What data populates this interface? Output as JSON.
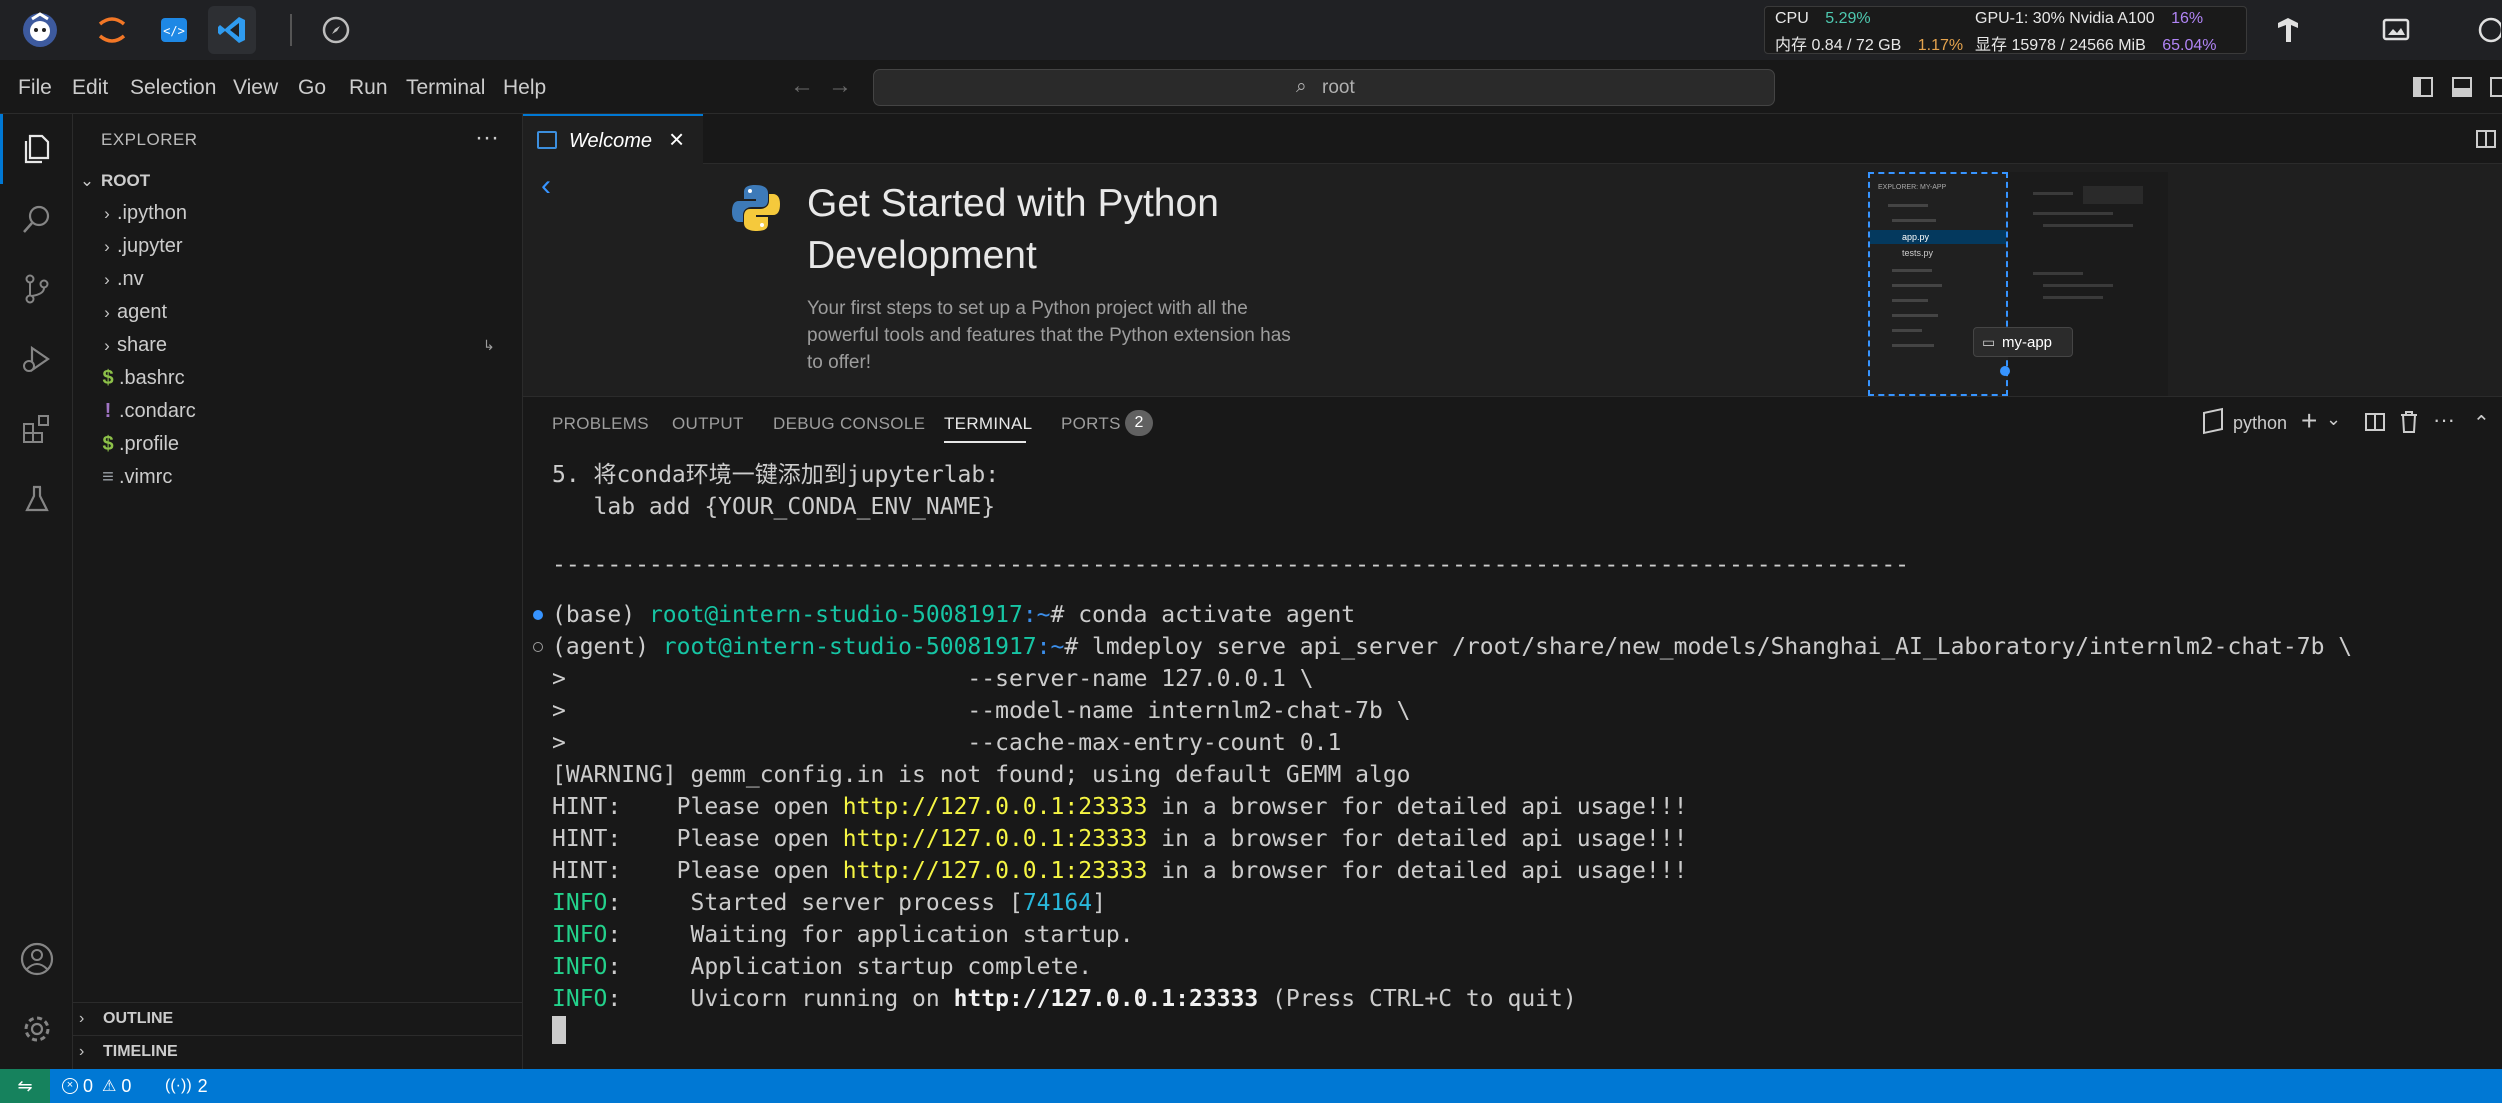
{
  "system_bar": {
    "cpu_label": "CPU",
    "cpu_value": "5.29%",
    "gpu_label": "GPU-1: 30% Nvidia A100",
    "gpu_value": "16%",
    "mem_label": "内存 0.84 / 72 GB",
    "mem_value": "1.17%",
    "vram_label": "显存 15978 / 24566 MiB",
    "vram_value": "65.04%",
    "colors": {
      "green": "#4ec9b0",
      "orange": "#e5a34d",
      "purple": "#b084f5"
    }
  },
  "menu": {
    "items": [
      "File",
      "Edit",
      "Selection",
      "View",
      "Go",
      "Run",
      "Terminal",
      "Help"
    ],
    "command_center": "root"
  },
  "sidebar": {
    "title": "EXPLORER",
    "root_label": "ROOT",
    "items": [
      {
        "label": ".ipython",
        "kind": "folder"
      },
      {
        "label": ".jupyter",
        "kind": "folder"
      },
      {
        "label": ".nv",
        "kind": "folder"
      },
      {
        "label": "agent",
        "kind": "folder"
      },
      {
        "label": "share",
        "kind": "folder"
      },
      {
        "label": ".bashrc",
        "kind": "file",
        "glyph": "$",
        "color": "#8dc149"
      },
      {
        "label": ".condarc",
        "kind": "file",
        "glyph": "!",
        "color": "#a074c4"
      },
      {
        "label": ".profile",
        "kind": "file",
        "glyph": "$",
        "color": "#8dc149"
      },
      {
        "label": ".vimrc",
        "kind": "file",
        "glyph": "≡",
        "color": "#9aa0a6"
      }
    ],
    "outline_label": "OUTLINE",
    "timeline_label": "TIMELINE"
  },
  "editor": {
    "tab_label": "Welcome",
    "welcome": {
      "title_line1": "Get Started with Python",
      "title_line2": "Development",
      "desc_line1": "Your first steps to set up a Python project with all the",
      "desc_line2": "powerful tools and features that the Python extension has",
      "desc_line3": "to offer!",
      "preview_header": "EXPLORER: MY-APP",
      "preview_file1": "app.py",
      "preview_file2": "tests.py",
      "preview_tooltip": "my-app"
    }
  },
  "panel": {
    "tabs": [
      "PROBLEMS",
      "OUTPUT",
      "DEBUG CONSOLE",
      "TERMINAL",
      "PORTS"
    ],
    "ports_badge": "2",
    "terminal_profile": "python"
  },
  "terminal": {
    "l1": "5. 将conda环境一键添加到jupyterlab:",
    "l2": "   lab add {YOUR_CONDA_ENV_NAME}",
    "separator": "--------------------------------------------------------------------------------------------------",
    "p1_env": "(base) ",
    "p1_host": "root@intern-studio-50081917",
    "p1_path": ":~",
    "p1_cmd": "# conda activate agent",
    "p2_env": "(agent) ",
    "p2_host": "root@intern-studio-50081917",
    "p2_path": ":~",
    "p2_cmd": "# lmdeploy serve api_server /root/share/new_models/Shanghai_AI_Laboratory/internlm2-chat-7b \\",
    "c1": ">                             --server-name 127.0.0.1 \\",
    "c2": ">                             --model-name internlm2-chat-7b \\",
    "c3": ">                             --cache-max-entry-count 0.1",
    "warn": "[WARNING] gemm_config.in is not found; using default GEMM algo",
    "hint_label": "HINT:    Please open ",
    "hint_url": "http://127.0.0.1:23333",
    "hint_tail": " in a browser for detailed api usage!!!",
    "info_label": "INFO",
    "info1_pre": ":     Started server process [",
    "info1_pid": "74164",
    "info1_post": "]",
    "info2": ":     Waiting for application startup.",
    "info3": ":     Application startup complete.",
    "info4_pre": ":     Uvicorn running on ",
    "info4_url": "http://127.0.0.1:23333",
    "info4_post": " (Press CTRL+C to quit)"
  },
  "status_bar": {
    "errors": "0",
    "warnings": "0",
    "ports": "2"
  }
}
